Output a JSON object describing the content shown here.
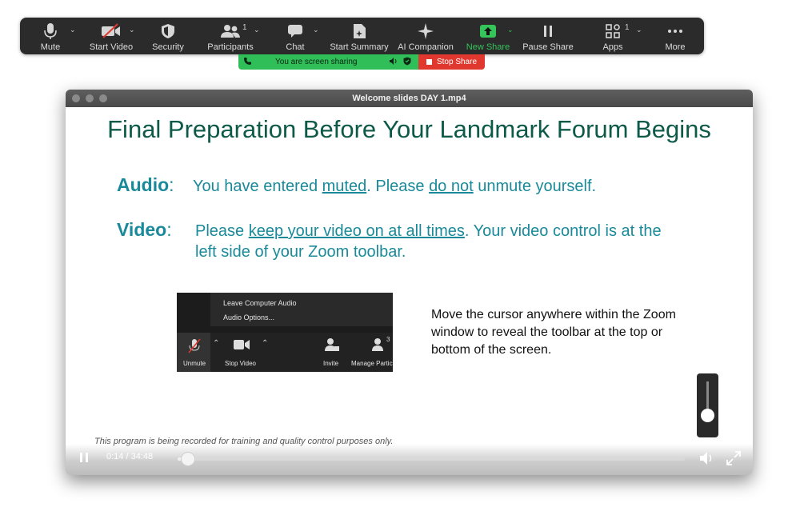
{
  "toolbar": {
    "items": [
      {
        "label": "Mute",
        "icon": "microphone-icon"
      },
      {
        "label": "Start Video",
        "icon": "camera-off-icon"
      },
      {
        "label": "Security",
        "icon": "shield-icon"
      },
      {
        "label": "Participants",
        "icon": "participants-icon",
        "count": "1"
      },
      {
        "label": "Chat",
        "icon": "chat-icon"
      },
      {
        "label": "Start Summary",
        "icon": "summary-icon"
      },
      {
        "label": "AI Companion",
        "icon": "sparkle-icon"
      },
      {
        "label": "New Share",
        "icon": "share-arrow-icon"
      },
      {
        "label": "Pause Share",
        "icon": "pause-icon"
      },
      {
        "label": "Apps",
        "icon": "apps-icon",
        "count": "1"
      },
      {
        "label": "More",
        "icon": "more-icon"
      }
    ],
    "colors": {
      "background": "#2b2b2b",
      "active": "#35c45a"
    }
  },
  "share_bar": {
    "status": "You are screen sharing",
    "stop_label": "Stop Share",
    "colors": {
      "green": "#2fbe58",
      "red": "#e0382f"
    }
  },
  "player": {
    "window_title": "Welcome slides DAY 1.mp4",
    "time": "0:14 / 34:48",
    "progress": 0.0067,
    "volume": 0.3
  },
  "slide": {
    "title": "Final Preparation Before Your Landmark Forum Begins",
    "audio_label": "Audio",
    "audio_text_1": "You have entered",
    "audio_link_1": "muted",
    "audio_text_2": ". Please",
    "audio_link_2": "do not",
    "audio_text_3": "unmute yourself.",
    "video_label": "Video",
    "video_text_1": "Please",
    "video_link_1": "keep your video on at all times",
    "video_text_2": ". Your video control is at the",
    "video_text_3": "left side of your Zoom toolbar.",
    "cursor_note": "Move the cursor anywhere within the Zoom window to reveal the toolbar at the top or bottom of the screen.",
    "caption": "This program is being recorded for training and quality control purposes only.",
    "colors": {
      "title": "#0e5a49",
      "teal": "#1a8a9a"
    }
  },
  "embedded_screenshot": {
    "menu_items": [
      "Leave Computer Audio",
      "Audio Options..."
    ],
    "buttons": [
      "Unmute",
      "Stop Video",
      "Invite",
      "Manage Partici"
    ],
    "participant_count": "3"
  }
}
